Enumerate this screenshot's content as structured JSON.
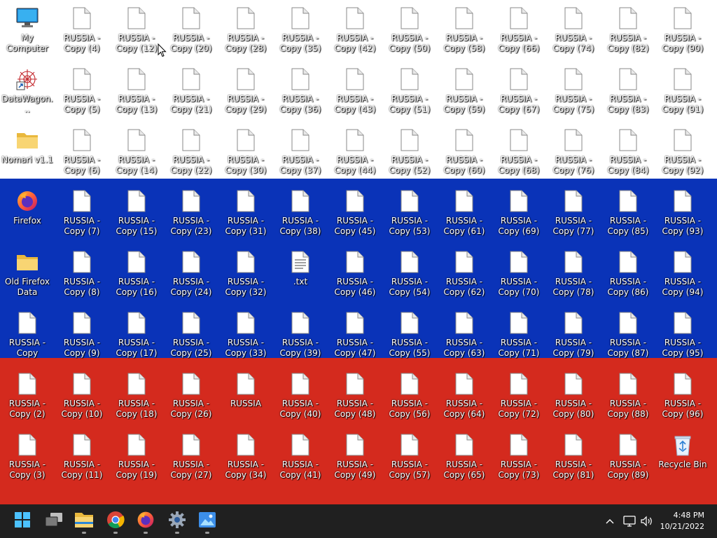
{
  "desktop": {
    "flag_colors": [
      "#ffffff",
      "#0a33b8",
      "#d42a1e"
    ],
    "columns": [
      [
        "My Computer",
        "DataWagon...",
        "Nomari v1.1",
        "Firefox",
        "Old Firefox Data",
        "RUSSIA - Copy",
        "RUSSIA - Copy (2)",
        "RUSSIA - Copy (3)"
      ],
      [
        "RUSSIA - Copy (4)",
        "RUSSIA - Copy (5)",
        "RUSSIA - Copy (6)",
        "RUSSIA - Copy (7)",
        "RUSSIA - Copy (8)",
        "RUSSIA - Copy (9)",
        "RUSSIA - Copy (10)",
        "RUSSIA - Copy (11)"
      ],
      [
        "RUSSIA - Copy (12)",
        "RUSSIA - Copy (13)",
        "RUSSIA - Copy (14)",
        "RUSSIA - Copy (15)",
        "RUSSIA - Copy (16)",
        "RUSSIA - Copy (17)",
        "RUSSIA - Copy (18)",
        "RUSSIA - Copy (19)"
      ],
      [
        "RUSSIA - Copy (20)",
        "RUSSIA - Copy (21)",
        "RUSSIA - Copy (22)",
        "RUSSIA - Copy (23)",
        "RUSSIA - Copy (24)",
        "RUSSIA - Copy (25)",
        "RUSSIA - Copy (26)",
        "RUSSIA - Copy (27)"
      ],
      [
        "RUSSIA - Copy (28)",
        "RUSSIA - Copy (29)",
        "RUSSIA - Copy (30)",
        "RUSSIA - Copy (31)",
        "RUSSIA - Copy (32)",
        "RUSSIA - Copy (33)",
        "RUSSIA",
        "RUSSIA - Copy (34)"
      ],
      [
        "RUSSIA - Copy (35)",
        "RUSSIA - Copy (36)",
        "RUSSIA - Copy (37)",
        "RUSSIA - Copy (38)",
        ".txt",
        "RUSSIA - Copy (39)",
        "RUSSIA - Copy (40)",
        "RUSSIA - Copy (41)"
      ],
      [
        "RUSSIA - Copy (42)",
        "RUSSIA - Copy (43)",
        "RUSSIA - Copy (44)",
        "RUSSIA - Copy (45)",
        "RUSSIA - Copy (46)",
        "RUSSIA - Copy (47)",
        "RUSSIA - Copy (48)",
        "RUSSIA - Copy (49)"
      ],
      [
        "RUSSIA - Copy (50)",
        "RUSSIA - Copy (51)",
        "RUSSIA - Copy (52)",
        "RUSSIA - Copy (53)",
        "RUSSIA - Copy (54)",
        "RUSSIA - Copy (55)",
        "RUSSIA - Copy (56)",
        "RUSSIA - Copy (57)"
      ],
      [
        "RUSSIA - Copy (58)",
        "RUSSIA - Copy (59)",
        "RUSSIA - Copy (60)",
        "RUSSIA - Copy (61)",
        "RUSSIA - Copy (62)",
        "RUSSIA - Copy (63)",
        "RUSSIA - Copy (64)",
        "RUSSIA - Copy (65)"
      ],
      [
        "RUSSIA - Copy (66)",
        "RUSSIA - Copy (67)",
        "RUSSIA - Copy (68)",
        "RUSSIA - Copy (69)",
        "RUSSIA - Copy (70)",
        "RUSSIA - Copy (71)",
        "RUSSIA - Copy (72)",
        "RUSSIA - Copy (73)"
      ],
      [
        "RUSSIA - Copy (74)",
        "RUSSIA - Copy (75)",
        "RUSSIA - Copy (76)",
        "RUSSIA - Copy (77)",
        "RUSSIA - Copy (78)",
        "RUSSIA - Copy (79)",
        "RUSSIA - Copy (80)",
        "RUSSIA - Copy (81)"
      ],
      [
        "RUSSIA - Copy (82)",
        "RUSSIA - Copy (83)",
        "RUSSIA - Copy (84)",
        "RUSSIA - Copy (85)",
        "RUSSIA - Copy (86)",
        "RUSSIA - Copy (87)",
        "RUSSIA - Copy (88)",
        "RUSSIA - Copy (89)"
      ],
      [
        "RUSSIA - Copy (90)",
        "RUSSIA - Copy (91)",
        "RUSSIA - Copy (92)",
        "RUSSIA - Copy (93)",
        "RUSSIA - Copy (94)",
        "RUSSIA - Copy (95)",
        "RUSSIA - Copy (96)",
        "Recycle Bin"
      ]
    ],
    "icon_types": {
      "My Computer": "monitor-icon",
      "DataWagon...": "datawagon-icon",
      "Nomari v1.1": "folder-icon",
      "Firefox": "firefox-icon",
      "Old Firefox Data": "folder-icon",
      ".txt": "text-file-icon",
      "Recycle Bin": "recycle-bin-icon",
      "default": "blank-file-icon"
    }
  },
  "taskbar": {
    "buttons": [
      "start-icon",
      "task-view-icon",
      "file-explorer-icon",
      "chrome-icon",
      "firefox-icon",
      "settings-icon",
      "photos-icon"
    ],
    "tray": [
      "chevron-up-icon",
      "network-icon",
      "volume-icon"
    ],
    "clock": {
      "time": "4:48 PM",
      "date": "10/21/2022"
    }
  }
}
